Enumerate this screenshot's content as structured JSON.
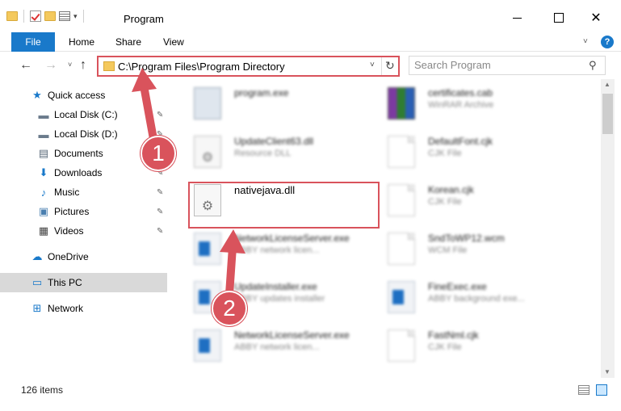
{
  "window": {
    "title": "Program",
    "close_glyph": "✕"
  },
  "ribbon": {
    "file_label": "File",
    "tabs": [
      "Home",
      "Share",
      "View"
    ],
    "help_glyph": "?",
    "expand_glyph": "˅"
  },
  "nav": {
    "back_glyph": "←",
    "forward_glyph": "→",
    "recent_glyph": "˅",
    "up_glyph": "↑",
    "address": "C:\\Program Files\\Program Directory",
    "address_dropdown_glyph": "˅",
    "refresh_glyph": "↻",
    "search_placeholder": "Search Program",
    "search_glyph": "⚲"
  },
  "sidebar": {
    "pin_glyph": "✎",
    "items": [
      {
        "label": "Quick access",
        "icon": "star-icon",
        "glyph": "★",
        "color": "#1979ca"
      },
      {
        "label": "Local Disk (C:)",
        "icon": "drive-icon",
        "glyph": "▬",
        "color": "#6b7b8c",
        "pinned": true
      },
      {
        "label": "Local Disk (D:)",
        "icon": "drive-icon",
        "glyph": "▬",
        "color": "#6b7b8c",
        "pinned": true
      },
      {
        "label": "Documents",
        "icon": "document-icon",
        "glyph": "▤",
        "color": "#5a6a7a",
        "pinned": true
      },
      {
        "label": "Downloads",
        "icon": "download-icon",
        "glyph": "⬇",
        "color": "#1979ca",
        "pinned": true
      },
      {
        "label": "Music",
        "icon": "music-icon",
        "glyph": "♪",
        "color": "#1979ca",
        "pinned": true
      },
      {
        "label": "Pictures",
        "icon": "pictures-icon",
        "glyph": "▣",
        "color": "#4a7fb0",
        "pinned": true
      },
      {
        "label": "Videos",
        "icon": "video-icon",
        "glyph": "▦",
        "color": "#444444",
        "pinned": true
      },
      {
        "label": "OneDrive",
        "icon": "cloud-icon",
        "glyph": "☁",
        "color": "#1979ca"
      },
      {
        "label": "This PC",
        "icon": "computer-icon",
        "glyph": "▭",
        "color": "#1979ca",
        "selected": true
      },
      {
        "label": "Network",
        "icon": "network-icon",
        "glyph": "⊞",
        "color": "#1979ca"
      }
    ]
  },
  "files": [
    {
      "name": "program.exe",
      "type": "",
      "icon": "exe-icon"
    },
    {
      "name": "certificates.cab",
      "type": "WinRAR Archive",
      "icon": "rar-icon"
    },
    {
      "name": "UpdateClient63.dll",
      "type": "Resource DLL",
      "icon": "dll-icon"
    },
    {
      "name": "DefaultFont.cjk",
      "type": "CJK File",
      "icon": "file-icon"
    },
    {
      "name": "nativejava.dll",
      "type": "",
      "icon": "dll-gear-icon"
    },
    {
      "name": "Korean.cjk",
      "type": "CJK File",
      "icon": "file-icon"
    },
    {
      "name": "NetworkLicenseServer.exe",
      "type": "ABBY network licen...",
      "icon": "app-icon"
    },
    {
      "name": "SndToWP12.wcm",
      "type": "WCM File",
      "icon": "file-icon"
    },
    {
      "name": "UpdateInstaller.exe",
      "type": "ABBY updates installer",
      "icon": "app-icon"
    },
    {
      "name": "FineExec.exe",
      "type": "ABBY background exe...",
      "icon": "app-icon"
    },
    {
      "name": "NetworkLicenseServer.exe",
      "type": "ABBY network licen...",
      "icon": "app-icon"
    },
    {
      "name": "FastNml.cjk",
      "type": "CJK File",
      "icon": "file-icon"
    }
  ],
  "annotations": {
    "callout_1": "1",
    "callout_2": "2",
    "accent": "#d9535c"
  },
  "status": {
    "item_count": "126 items"
  },
  "colors": {
    "accent_blue": "#1979ca",
    "highlight_red": "#d9535c"
  }
}
